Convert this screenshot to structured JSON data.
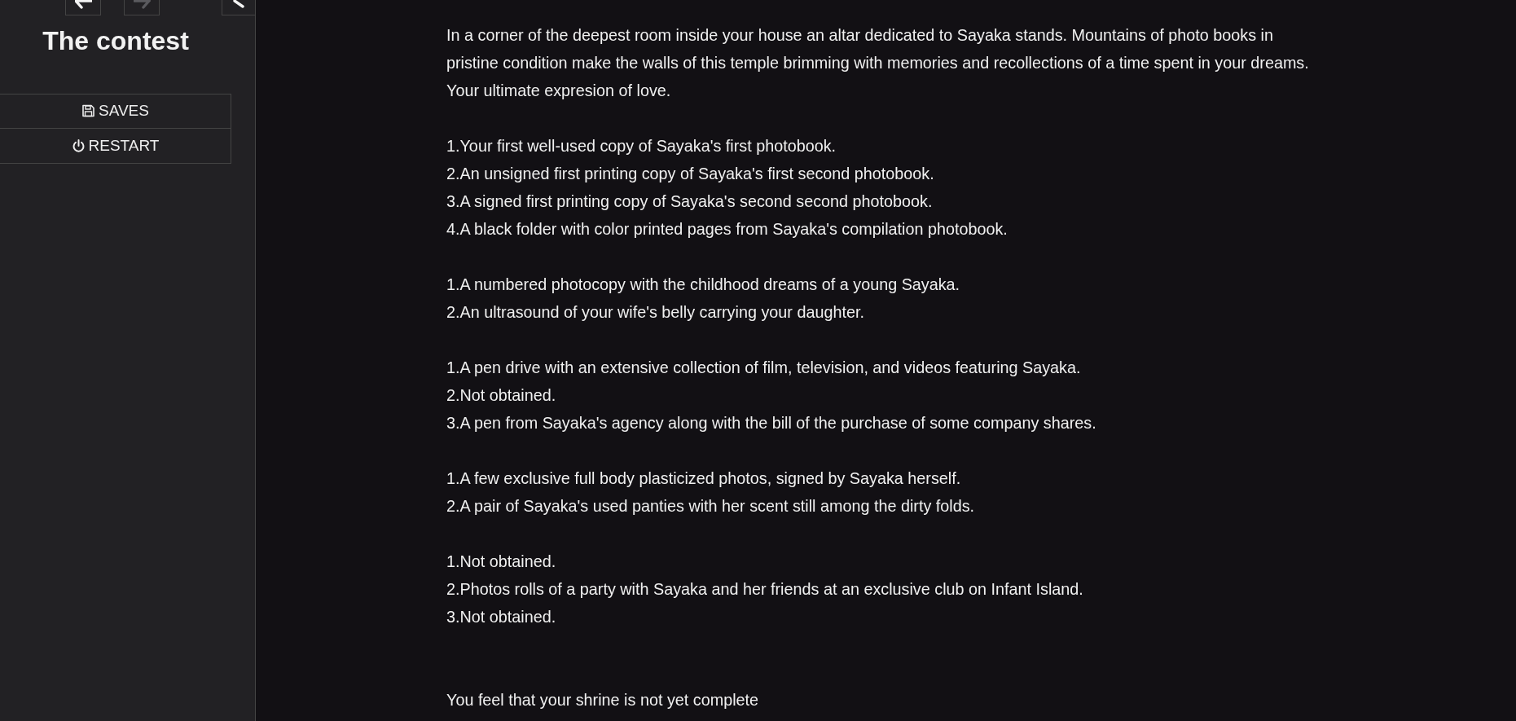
{
  "sidebar": {
    "history_buttons": [
      {
        "kind": "back",
        "disabled": false
      },
      {
        "kind": "forward",
        "disabled": true
      }
    ],
    "story_title": "The contest",
    "menu": [
      {
        "kind": "saves",
        "label": "SAVES"
      },
      {
        "kind": "restart",
        "label": "RESTART"
      }
    ]
  },
  "passage": {
    "intro": "In a corner of the deepest room inside your house an altar dedicated to Sayaka stands. Mountains of photo books in pristine condition make the walls of this temple brimming with memories and recollections of a time spent in your dreams. Your ultimate expresion of love.",
    "item_groups": [
      [
        "1.Your first well-used copy of Sayaka's first photobook.",
        "2.An unsigned first printing copy of Sayaka's first second photobook.",
        "3.A signed first printing copy of Sayaka's second second photobook.",
        "4.A black folder with color printed pages from Sayaka's compilation photobook."
      ],
      [
        "1.A numbered photocopy with the childhood dreams of a young Sayaka.",
        "2.An ultrasound of your wife's belly carrying your daughter."
      ],
      [
        "1.A pen drive with an extensive collection of film, television, and videos featuring Sayaka.",
        "2.Not obtained.",
        "3.A pen from Sayaka's agency along with the bill of the purchase of some company shares."
      ],
      [
        "1.A few exclusive full body plasticized photos, signed by Sayaka herself.",
        "2.A pair of Sayaka's used panties with her scent still among the dirty folds."
      ],
      [
        "1.Not obtained.",
        "2.Photos rolls of a party with Sayaka and her friends at an exclusive club on Infant Island.",
        "3.Not obtained."
      ]
    ],
    "closing": "You feel that your shrine is not yet complete"
  }
}
